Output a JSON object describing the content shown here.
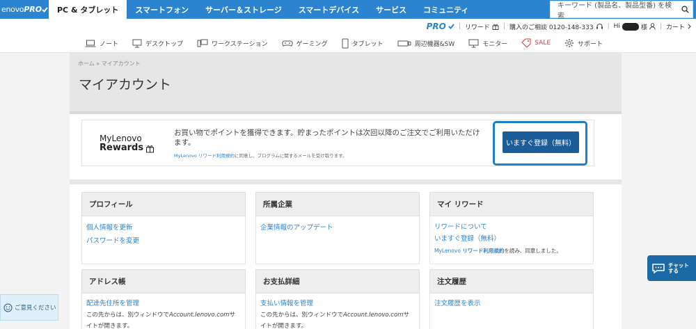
{
  "brand": {
    "logo_text": "enovo",
    "logo_pro": "PRO"
  },
  "nav": {
    "tabs": [
      {
        "label": "PC & タブレット"
      },
      {
        "label": "スマートフォン"
      },
      {
        "label": "サーバー＆ストレージ"
      },
      {
        "label": "スマートデバイス"
      },
      {
        "label": "サービス"
      },
      {
        "label": "コミュニティ"
      }
    ],
    "search_placeholder": "キーワード (製品名、製品型番) を検索"
  },
  "utility": {
    "pro": "PRO",
    "rewards": "リワード",
    "consult": "購入のご相談 0120-148-333",
    "greeting": "Hi",
    "greeting_suffix": "様",
    "cart": "カート"
  },
  "categories": [
    {
      "label": "ノート",
      "icon": "laptop-icon"
    },
    {
      "label": "デスクトップ",
      "icon": "desktop-icon"
    },
    {
      "label": "ワークステーション",
      "icon": "workstation-icon"
    },
    {
      "label": "ゲーミング",
      "icon": "gamepad-icon"
    },
    {
      "label": "タブレット",
      "icon": "tablet-icon"
    },
    {
      "label": "周辺機器&SW",
      "icon": "peripheral-icon"
    },
    {
      "label": "モニター",
      "icon": "monitor-icon"
    },
    {
      "label": "SALE",
      "icon": "tag-icon"
    },
    {
      "label": "サポート",
      "icon": "gear-icon"
    }
  ],
  "breadcrumb": "ホーム » マイアカウント",
  "page_title": "マイアカウント",
  "rewards_banner": {
    "logo_line1": "MyLenovo",
    "logo_line2": "Rewards",
    "text": "お買い物でポイントを獲得できます。貯まったポイントは次回以降のご注文でご利用いただけます。",
    "note_link": "MyLenovo リワード利用規約",
    "note_rest": "に同意し、プログラムに関するメールを受け取ります。",
    "button": "いますぐ登録（無料）"
  },
  "cards": {
    "profile": {
      "title": "プロフィール",
      "links": [
        "個人情報を更新",
        "パスワードを変更"
      ]
    },
    "company": {
      "title": "所属企業",
      "links": [
        "企業情報のアップデート"
      ]
    },
    "rewards": {
      "title": "マイ リワード",
      "links": [
        "リワードについて",
        "いますぐ登録（無料）"
      ],
      "note_prefix": "MyLenovo",
      "note_link": "リワード利用規約",
      "note_rest": "を読み、同意しました。"
    },
    "address": {
      "title": "アドレス帳",
      "link": "配達先住所を管理",
      "note_a": "この先からは、別ウィンドウで",
      "note_site": "Account.lenovo.com",
      "note_b": "サイトが開きます。"
    },
    "payment": {
      "title": "お支払詳細",
      "link": "支払い情報を管理",
      "note_a": "この先からは、別ウィンドウで",
      "note_site": "Account.lenovo.com",
      "note_b": "サイトが開きます。"
    },
    "orders": {
      "title": "注文履歴",
      "link": "注文履歴を表示"
    }
  },
  "widgets": {
    "feedback": "ご意見ください",
    "chat_line1": "チャット",
    "chat_line2": "する"
  },
  "colors": {
    "primary": "#2c84d0",
    "button": "#1c5d99",
    "sale": "#d83b3b"
  }
}
